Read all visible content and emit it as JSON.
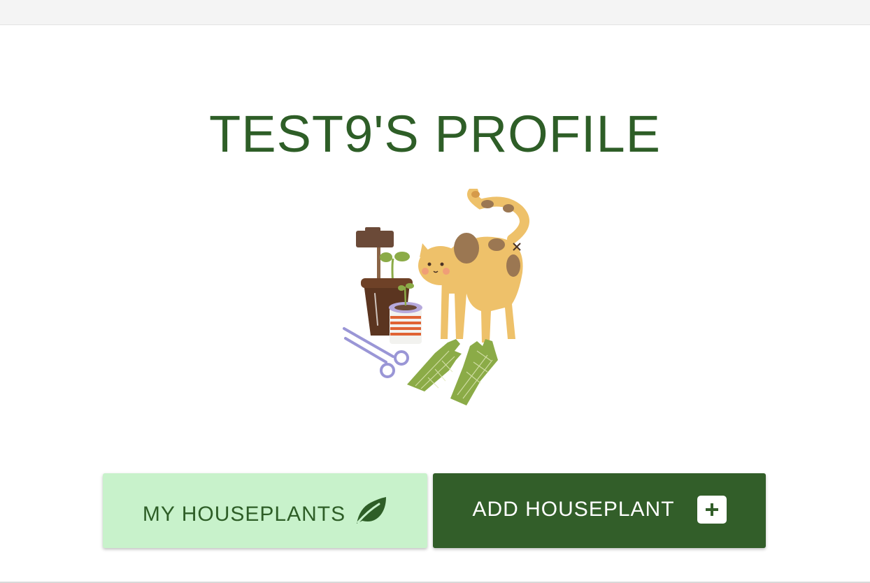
{
  "profile": {
    "title": "TEST9'S PROFILE"
  },
  "actions": {
    "my_houseplants_label": "MY HOUSEPLANTS",
    "add_houseplant_label": "ADD HOUSEPLANT"
  },
  "icons": {
    "my_houseplants": "leaf-icon",
    "add_houseplant": "plus-square-icon"
  },
  "colors": {
    "primary_green": "#325e29",
    "light_green": "#c8f2cb",
    "title_green": "#2e5e27"
  }
}
